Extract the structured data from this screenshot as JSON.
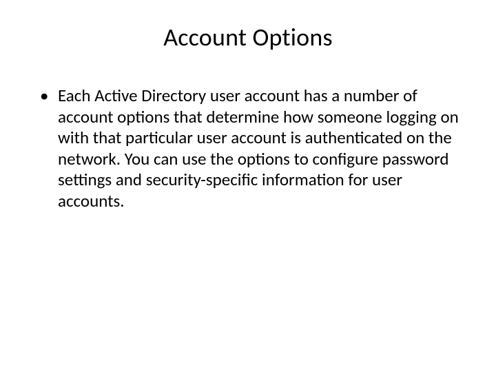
{
  "slide": {
    "title": "Account Options",
    "bullets": [
      "Each Active Directory user account has a number of account options that determine how someone logging on with that particular user account is authenticated on the network. You can use the options to configure password settings and security-specific information for user accounts."
    ]
  }
}
